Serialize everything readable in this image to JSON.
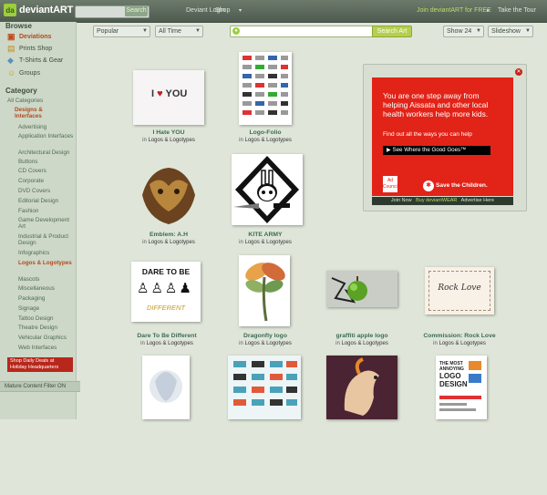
{
  "topbar": {
    "logo_text": "deviantART",
    "search_button": "Search",
    "deviant_login": "Deviant Login",
    "shop": "Shop",
    "join": "Join deviantART for FREE",
    "tour": "Take the Tour"
  },
  "sidebar": {
    "browse_heading": "Browse",
    "browse": [
      {
        "label": "Deviations",
        "icon": "deviations-icon"
      },
      {
        "label": "Prints Shop",
        "icon": "prints-icon"
      },
      {
        "label": "T-Shirts & Gear",
        "icon": "tshirt-icon"
      },
      {
        "label": "Groups",
        "icon": "groups-icon"
      }
    ],
    "category_heading": "Category",
    "all_categories": "All Categories",
    "parent_category": "Designs & Interfaces",
    "categories": [
      "Advertising",
      "Application Interfaces",
      "Architectural Design",
      "Buttons",
      "CD Covers",
      "Corporate",
      "DVD Covers",
      "Editorial Design",
      "Fashion",
      "Game Development Art",
      "Industrial & Product Design",
      "Infographics",
      "Logos & Logotypes",
      "Mascots",
      "Miscellaneous",
      "Packaging",
      "Signage",
      "Tattoo Design",
      "Theatre Design",
      "Vehicular Graphics",
      "Web Interfaces"
    ],
    "promo": "Shop Daily Deals at Holiday Headquarters",
    "mature_filter": "Mature Content Filter ON"
  },
  "controls": {
    "sort": "Popular",
    "time": "All Time",
    "search_placeholder": "",
    "search_button": "Search Art",
    "show": "Show 24",
    "slideshow": "Slideshow"
  },
  "thumbs": [
    {
      "title": "I Hate YOU",
      "sub_prefix": "in",
      "category": "Logos & Logotypes"
    },
    {
      "title": "Logo-Folio",
      "sub_prefix": "in",
      "category": "Logos & Logotypes"
    },
    {
      "title": "Emblem: A.H",
      "sub_prefix": "in",
      "category": "Logos & Logotypes"
    },
    {
      "title": "KITE ARMY",
      "sub_prefix": "in",
      "category": "Logos & Logotypes"
    },
    {
      "title": "Dare To Be Different",
      "sub_prefix": "in",
      "category": "Logos & Logotypes"
    },
    {
      "title": "Dragonfly logo",
      "sub_prefix": "in",
      "category": "Logos & Logotypes"
    },
    {
      "title": "graffiti apple logo",
      "sub_prefix": "in",
      "category": "Logos & Logotypes"
    },
    {
      "title": "Commission: Rock Love",
      "sub_prefix": "in",
      "category": "Logos & Logotypes"
    }
  ],
  "thumb_text": {
    "ihateyou_a": "I",
    "ihateyou_b": "YOU",
    "dare_1": "DARE TO BE",
    "dare_2": "DIFFERENT",
    "rocklove": "Rock Love",
    "logo_design_1": "THE MOST",
    "logo_design_2": "ANNOYING",
    "logo_design_3": "LOGO",
    "logo_design_4": "DESIGN"
  },
  "ad": {
    "headline": "You are one step away from helping Aissata and other local health workers help more kids.",
    "subline": "Find out all the ways you can help",
    "cta": "See Where the Good Goes™",
    "council": "Ad Council",
    "brand": "Save the Children.",
    "footer_join": "Join Now",
    "footer_buy": "Buy deviantWEAR",
    "footer_advertise": "Advertise Here"
  }
}
